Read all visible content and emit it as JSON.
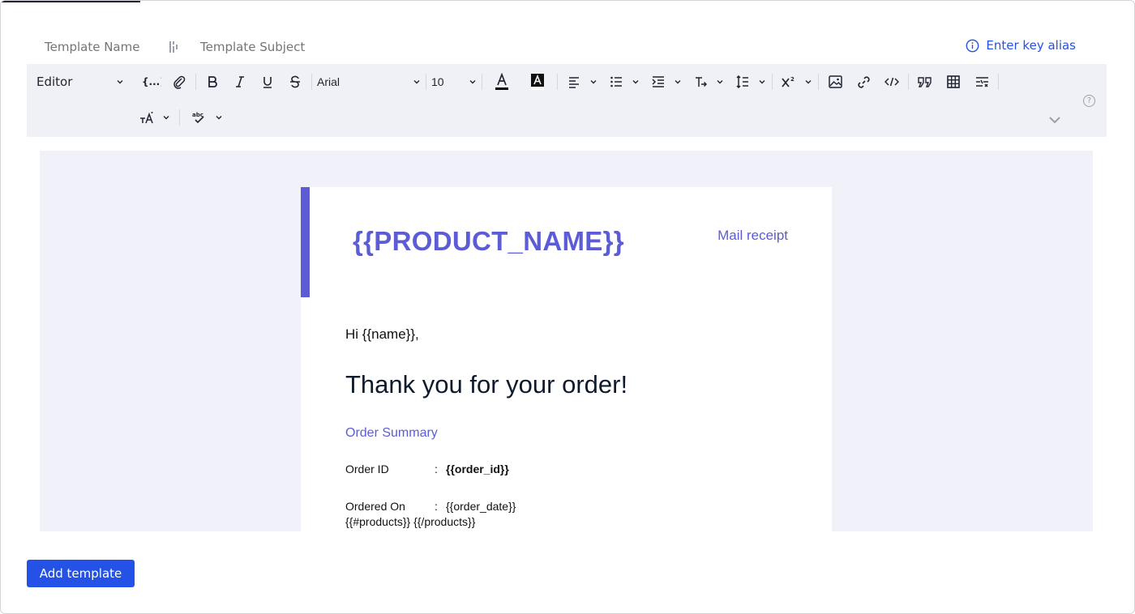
{
  "header": {
    "template_name_placeholder": "Template Name",
    "template_subject_placeholder": "Template Subject",
    "alias_label": "Enter key alias"
  },
  "toolbar": {
    "mode_label": "Editor",
    "font_family": "Arial",
    "font_size": "10",
    "icons": [
      "merge-field-icon",
      "attachment-icon",
      "bold-icon",
      "italic-icon",
      "underline-icon",
      "strikethrough-icon",
      "text-color-icon",
      "background-color-icon",
      "align-icon",
      "bullet-list-icon",
      "indent-icon",
      "text-direction-icon",
      "line-height-icon",
      "superscript-icon",
      "image-icon",
      "link-icon",
      "code-icon",
      "quote-icon",
      "table-icon",
      "clear-format-icon",
      "text-case-icon",
      "spellcheck-icon"
    ],
    "help_glyph": "?"
  },
  "mail": {
    "product_name": "{{PRODUCT_NAME}}",
    "receipt_link": "Mail receipt",
    "greeting": "Hi {{name}},",
    "headline": "Thank you for your order!",
    "summary_title": "Order Summary",
    "rows": [
      {
        "key": "Order ID",
        "colon": ":",
        "value": "{{order_id}}"
      },
      {
        "key": "Ordered On",
        "colon": ":",
        "value": "{{order_date}}"
      }
    ],
    "products_loop": "{{#products}} {{/products}}"
  },
  "footer": {
    "add_button": "Add template"
  },
  "colors": {
    "accent": "#5c5cd6",
    "primary": "#2552e6",
    "toolbar_bg": "#f0f1f6",
    "canvas_bg": "#f1f1f9"
  }
}
